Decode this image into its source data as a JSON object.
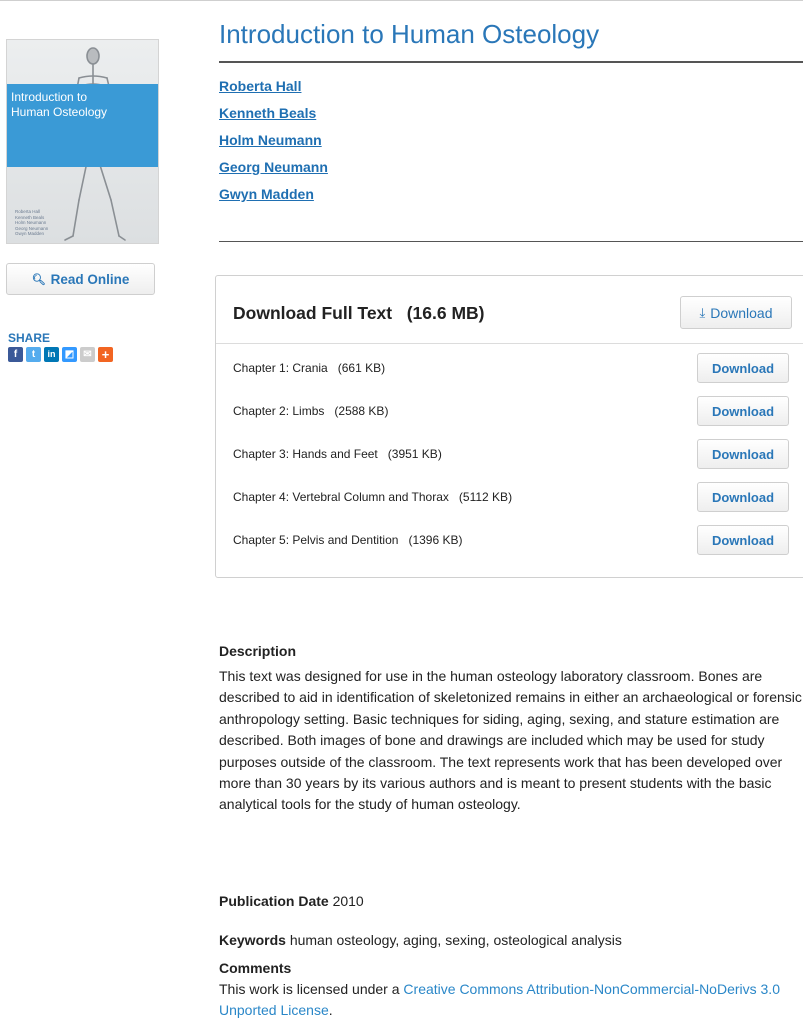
{
  "book": {
    "title": "Introduction to Human Osteology",
    "cover": {
      "title_line1": "Introduction to",
      "title_line2": "Human Osteology",
      "authors": [
        "Roberta Hall",
        "Kenneth Beals",
        "Holm Neumann",
        "Georg Neumann",
        "Gwyn Madden"
      ]
    },
    "authors": [
      "Roberta Hall",
      "Kenneth Beals",
      "Holm Neumann",
      "Georg Neumann",
      "Gwyn Madden"
    ]
  },
  "sidebar": {
    "read_online_label": "Read Online",
    "read_online_icon": "magnifier-icon",
    "share_label": "SHARE",
    "share_buttons": [
      {
        "name": "facebook-icon",
        "glyph": "f",
        "color": "#3b5998"
      },
      {
        "name": "twitter-icon",
        "glyph": "t",
        "color": "#55acee"
      },
      {
        "name": "linkedin-icon",
        "glyph": "in",
        "color": "#0077b5"
      },
      {
        "name": "delicious-icon",
        "glyph": "◩",
        "color": "#3399ff"
      },
      {
        "name": "email-icon",
        "glyph": "✉",
        "color": "#cccccc"
      },
      {
        "name": "addthis-icon",
        "glyph": "+",
        "color": "#f26522"
      }
    ]
  },
  "downloads": {
    "full_text_label": "Download Full Text",
    "full_text_size": "(16.6 MB)",
    "full_button_label": "Download",
    "full_button_icon": "download-icon",
    "chapters": [
      {
        "label": "Chapter 1: Crania",
        "size": "(661 KB)",
        "button": "Download"
      },
      {
        "label": "Chapter 2: Limbs",
        "size": "(2588 KB)",
        "button": "Download"
      },
      {
        "label": "Chapter 3: Hands and Feet",
        "size": "(3951 KB)",
        "button": "Download"
      },
      {
        "label": "Chapter 4: Vertebral Column and Thorax",
        "size": "(5112 KB)",
        "button": "Download"
      },
      {
        "label": "Chapter 5: Pelvis and Dentition",
        "size": "(1396 KB)",
        "button": "Download"
      }
    ]
  },
  "description": {
    "heading": "Description",
    "text": "This text was designed for use in the human osteology laboratory classroom. Bones are described to aid in identification of skeletonized remains in either an archaeological or forensic anthropology setting. Basic techniques for siding, aging, sexing, and stature estimation are described. Both images of bone and drawings are included which may be used for study purposes outside of the classroom. The text represents work that has been developed over more than 30 years by its various authors and is meant to present students with the basic analytical tools for the study of human osteology."
  },
  "publication": {
    "label": "Publication Date",
    "value": "2010"
  },
  "keywords": {
    "label": "Keywords",
    "value": "human osteology, aging, sexing, osteological analysis"
  },
  "comments": {
    "heading": "Comments",
    "prefix": "This work is licensed under a ",
    "link_text": "Creative Commons Attribution-NonCommercial-NoDerivs 3.0 Unported License",
    "suffix": "."
  }
}
